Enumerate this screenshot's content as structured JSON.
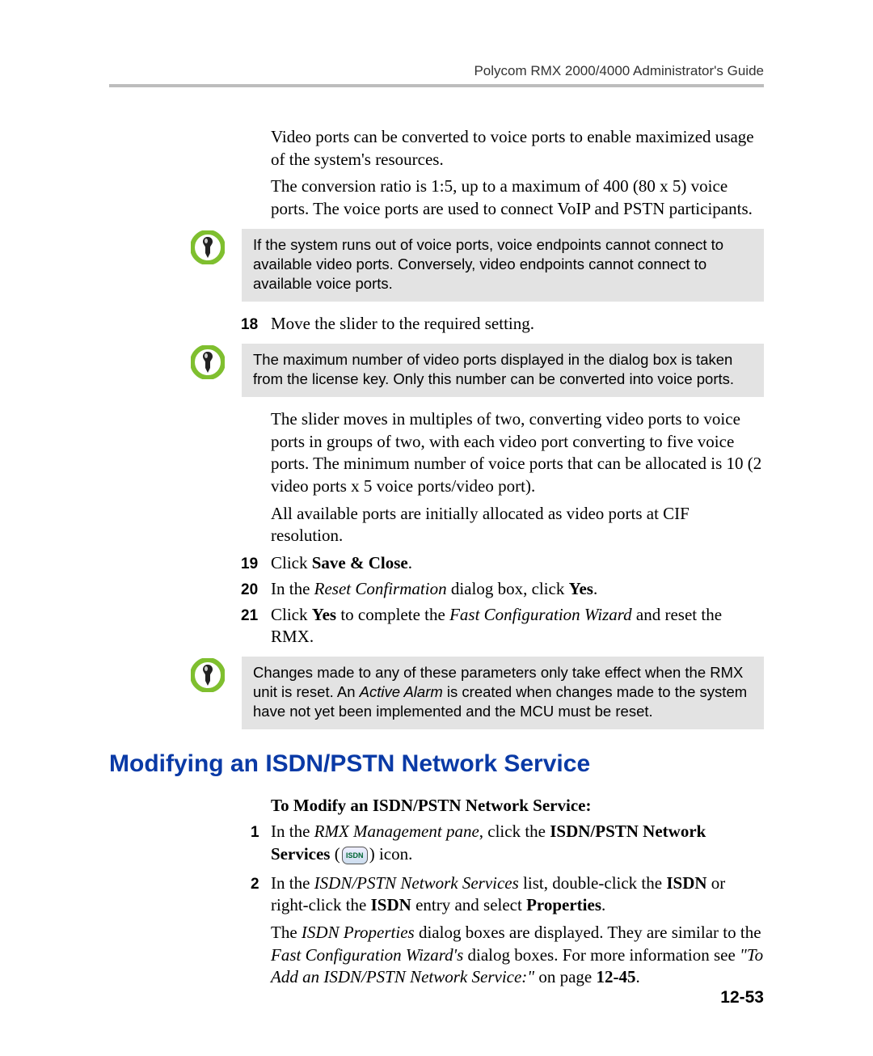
{
  "header": "Polycom RMX 2000/4000 Administrator's Guide",
  "intro": {
    "p1": "Video ports can be converted to voice ports to enable maximized usage of the system's resources.",
    "p2": "The conversion ratio is 1:5, up to a maximum of 400 (80 x 5) voice ports. The voice ports are used to connect VoIP and PSTN participants."
  },
  "note1": "If the system runs out of voice ports, voice endpoints cannot connect to available video ports. Conversely, video endpoints cannot connect to available voice ports.",
  "step18": {
    "num": "18",
    "text": "Move the slider to the required setting."
  },
  "note2": "The maximum number of video ports displayed in the dialog box is taken from the license key. Only this number can be converted into voice ports.",
  "slider": {
    "p1": "The slider moves in multiples of two, converting video ports to voice ports in groups of two, with each video port converting to five voice ports. The minimum number of voice ports that can be allocated is 10 (2 video ports x 5 voice ports/video port).",
    "p2": "All available ports are initially allocated as video ports at CIF resolution."
  },
  "step19": {
    "num": "19",
    "prefix": "Click ",
    "bold": "Save & Close",
    "suffix": "."
  },
  "step20": {
    "num": "20",
    "prefix": "In the ",
    "ital": "Reset Confirmation",
    "mid": " dialog box, click ",
    "bold": "Yes",
    "suffix": "."
  },
  "step21": {
    "num": "21",
    "prefix": "Click ",
    "bold1": "Yes",
    "mid": " to complete the ",
    "ital": "Fast Configuration Wizard",
    "suffix": " and reset the RMX."
  },
  "note3": {
    "pre": "Changes made to any of these parameters only take effect when the RMX unit is reset. An ",
    "ital": "Active Alarm",
    "post": " is created when changes made to the system have not yet been implemented and the MCU must be reset."
  },
  "heading": "Modifying an ISDN/PSTN Network Service",
  "subheading": "To Modify an ISDN/PSTN Network Service:",
  "m1": {
    "num": "1",
    "prefix": "In the ",
    "ital": "RMX Management pane",
    "mid": ", click the ",
    "bold": "ISDN/PSTN Network Services",
    "iconLabel": "ISDN",
    "paren_open": " (",
    "paren_close": ") icon."
  },
  "m2": {
    "num": "2",
    "prefix": "In the ",
    "ital": "ISDN/PSTN Network Services",
    "mid": " list, double-click the ",
    "bold1": "ISDN",
    "mid2": " or right-click the ",
    "bold2": "ISDN",
    "mid3": " entry and select ",
    "bold3": "Properties",
    "suffix": "."
  },
  "m2b": {
    "prefix": "The ",
    "ital1": "ISDN Properties",
    "mid1": " dialog boxes are displayed. They are similar to the ",
    "ital2": "Fast Configuration Wizard's",
    "mid2": " dialog boxes. For more information see ",
    "ital3": "\"To Add an ISDN/PSTN Network Service:\"",
    "mid3": " on page ",
    "bold": "12-45",
    "suffix": "."
  },
  "pageNumber": "12-53"
}
